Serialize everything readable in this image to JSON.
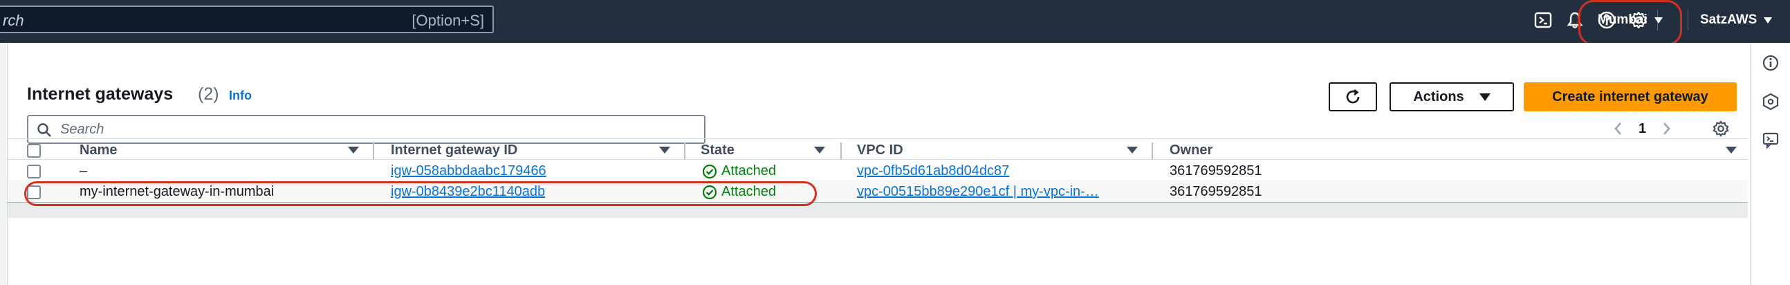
{
  "topbar": {
    "search_placeholder": "rch",
    "search_shortcut": "[Option+S]",
    "icons": [
      "cloudshell-icon",
      "bell-icon",
      "help-icon",
      "gear-icon"
    ],
    "region": "Mumbai",
    "account": "SatzAWS"
  },
  "page": {
    "title": "Internet gateways",
    "count": "(2)",
    "info": "Info",
    "actions_label": "Actions",
    "create_label": "Create internet gateway",
    "search_placeholder": "Search",
    "current_page": "1"
  },
  "table": {
    "columns": [
      "Name",
      "Internet gateway ID",
      "State",
      "VPC ID",
      "Owner"
    ],
    "rows": [
      {
        "name": "–",
        "igw_id": "igw-058abbdaabc179466",
        "state": "Attached",
        "vpc_id": "vpc-0fb5d61ab8d04dc87",
        "owner": "361769592851"
      },
      {
        "name": "my-internet-gateway-in-mumbai",
        "igw_id": "igw-0b8439e2bc1140adb",
        "state": "Attached",
        "vpc_id": "vpc-00515bb89e290e1cf | my-vpc-in-…",
        "owner": "361769592851"
      }
    ]
  },
  "colors": {
    "topbar": "#232f3e",
    "link": "#0972d3",
    "success": "#037f0c",
    "primary": "#ff9900",
    "annotation": "#d0321f"
  }
}
